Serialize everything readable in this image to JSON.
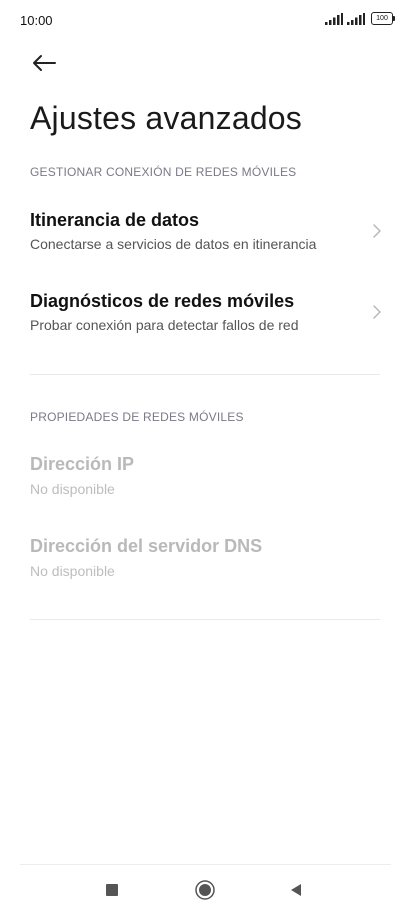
{
  "status": {
    "time": "10:00",
    "battery": "100"
  },
  "header": {
    "title": "Ajustes avanzados"
  },
  "sections": [
    {
      "header": "GESTIONAR CONEXIÓN DE REDES MÓVILES",
      "items": [
        {
          "title": "Itinerancia de datos",
          "subtitle": "Conectarse a servicios de datos en itinerancia"
        },
        {
          "title": "Diagnósticos de redes móviles",
          "subtitle": "Probar conexión para detectar fallos de red"
        }
      ]
    },
    {
      "header": "PROPIEDADES DE REDES MÓVILES",
      "items": [
        {
          "title": "Dirección IP",
          "subtitle": "No disponible"
        },
        {
          "title": "Dirección del servidor DNS",
          "subtitle": "No disponible"
        }
      ]
    }
  ],
  "icons": {
    "back": "arrow-left-icon",
    "chevron": "chevron-right-icon",
    "nav_recent": "square-icon",
    "nav_home": "circle-icon",
    "nav_back": "triangle-left-icon"
  },
  "colors": {
    "section_header": "#7a7a88",
    "disabled_text": "#b9b9b9"
  }
}
